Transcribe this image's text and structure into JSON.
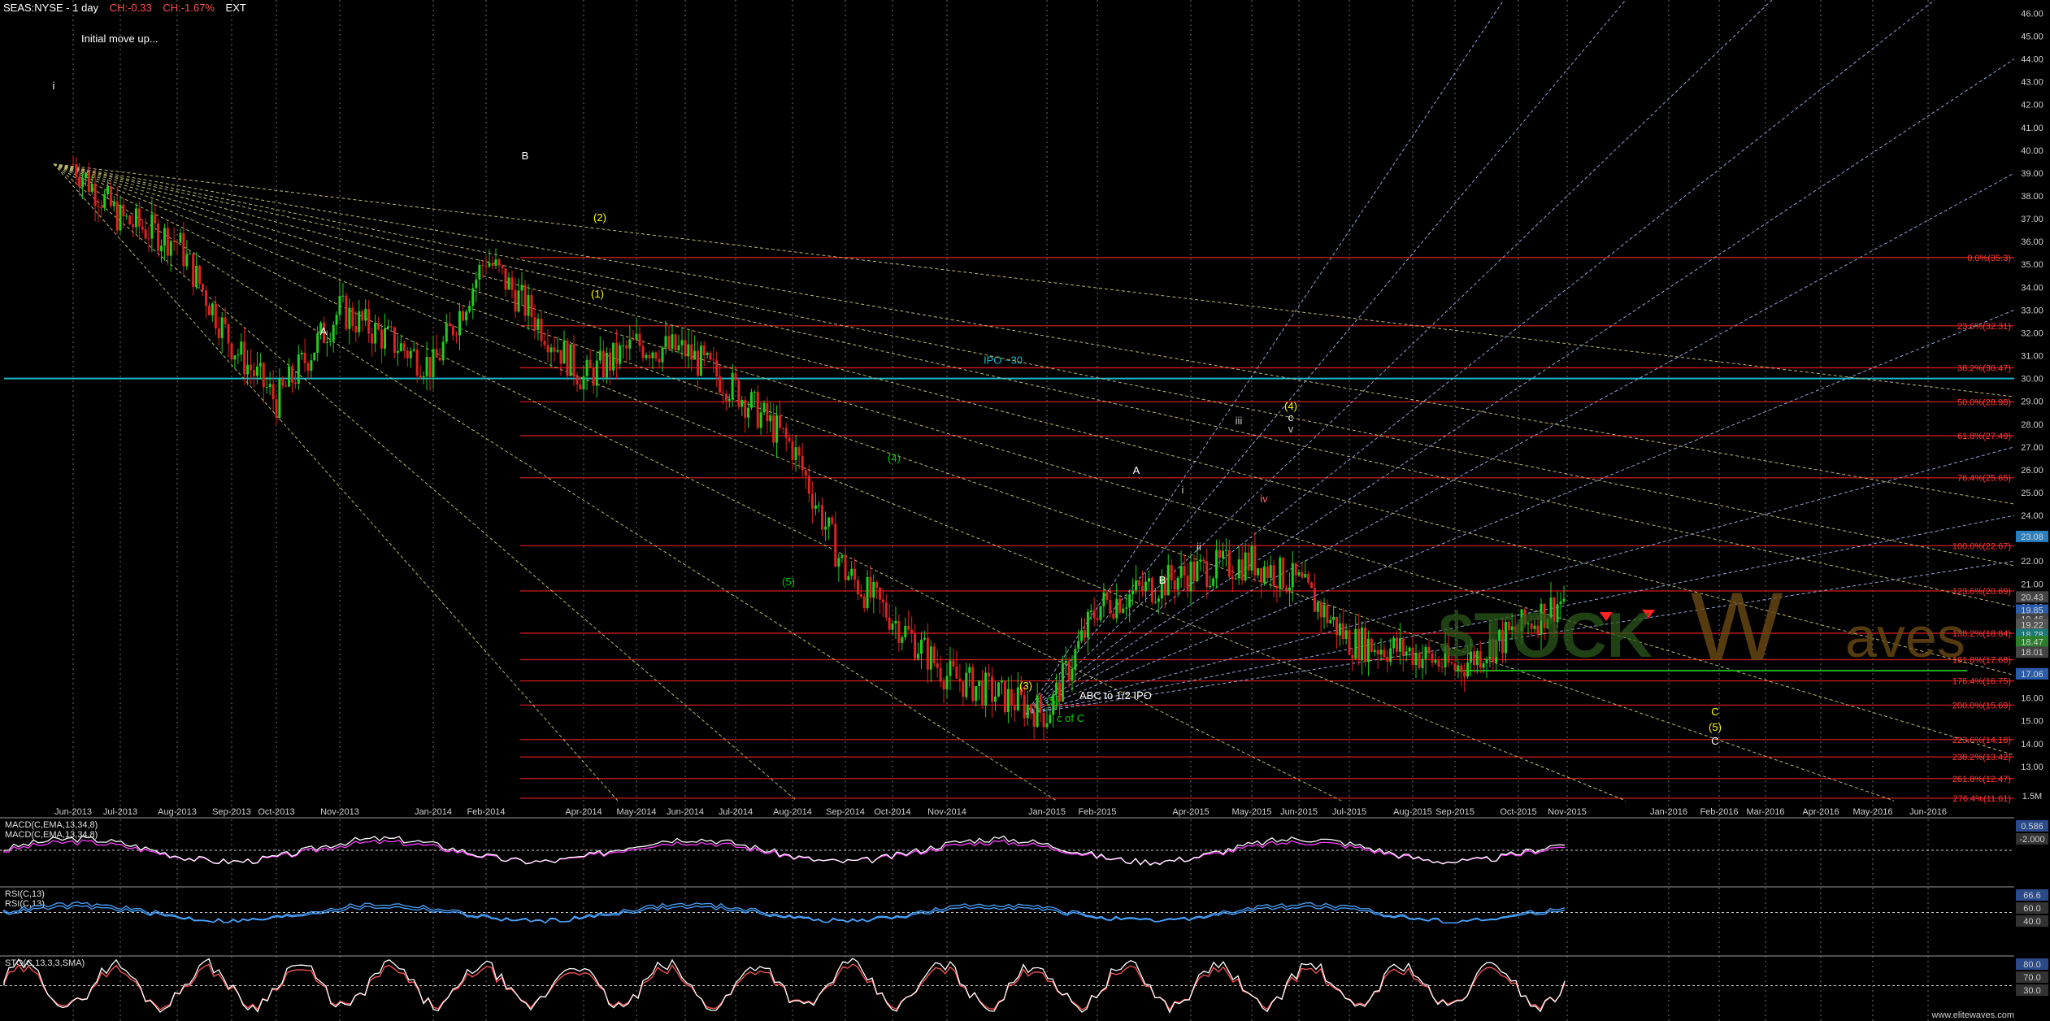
{
  "header": {
    "symbol": "SEAS:NYSE - 1 day",
    "change_abs": "CH:-0.33",
    "change_pct": "CH:-1.67%",
    "ext": "EXT"
  },
  "colors": {
    "background": "#000000",
    "candle_up": "#22cc22",
    "candle_down": "#dd2222",
    "fib_lines": "#d11b1b",
    "fan_yellow": "#bdb76b",
    "fan_blue": "#8fa4d8",
    "ipo_line": "#19b9c8",
    "macd_line": "#ffffff",
    "macd_signal": "#ff40ff",
    "rsi_line": "#4aa3ff",
    "stoch_k": "#ffffff",
    "stoch_d": "#ff5555",
    "watermark": "#2e5d1c"
  },
  "watermark": {
    "part1": "$TOCK",
    "part2": "aves",
    "w": "W",
    "site": "www.elitewaves.com"
  },
  "chart_data": {
    "type": "line",
    "title": "SEAS:NYSE - 1 day",
    "x_ticks": [
      "Jun-2013",
      "Jul-2013",
      "Aug-2013",
      "Sep-2013",
      "Oct-2013",
      "Nov-2013",
      "Jan-2014",
      "Feb-2014",
      "Apr-2014",
      "May-2014",
      "Jun-2014",
      "Jul-2014",
      "Aug-2014",
      "Sep-2014",
      "Oct-2014",
      "Nov-2014",
      "Jan-2015",
      "Feb-2015",
      "Apr-2015",
      "May-2015",
      "Jun-2015",
      "Jul-2015",
      "Aug-2015",
      "Sep-2015",
      "Oct-2015",
      "Nov-2015",
      "Jan-2016",
      "Feb-2016",
      "Mar-2016",
      "Apr-2016",
      "May-2016",
      "Jun-2016"
    ],
    "y_ticks": [
      13.0,
      14.0,
      15.0,
      16.0,
      17.0,
      18.0,
      19.0,
      20.0,
      21.0,
      22.0,
      23.0,
      24.0,
      25.0,
      26.0,
      27.0,
      28.0,
      29.0,
      30.0,
      31.0,
      32.0,
      33.0,
      34.0,
      35.0,
      36.0,
      37.0,
      38.0,
      39.0,
      40.0,
      41.0,
      42.0,
      43.0,
      44.0,
      45.0,
      46.0
    ],
    "ylim": [
      11.5,
      46.3
    ],
    "price_path": [
      [
        "Jun-2013",
        39.4
      ],
      [
        "Jul-2013",
        37.0
      ],
      [
        "Aug-2013",
        36.0
      ],
      [
        "Sep-2013",
        31.5
      ],
      [
        "Oct-2013",
        29.0
      ],
      [
        "Nov-2013",
        33.0
      ],
      [
        "Jan-2014",
        30.5
      ],
      [
        "Feb-2014",
        35.3
      ],
      [
        "Apr-2014",
        30.0
      ],
      [
        "May-2014",
        31.5
      ],
      [
        "Jun-2014",
        31.2
      ],
      [
        "Jul-2014",
        29.5
      ],
      [
        "Aug-2014",
        27.0
      ],
      [
        "Sep-2014",
        21.5
      ],
      [
        "Oct-2014",
        19.5
      ],
      [
        "Nov-2014",
        17.0
      ],
      [
        "Jan-2015",
        15.3
      ],
      [
        "Feb-2015",
        20.0
      ],
      [
        "Apr-2015",
        21.5
      ],
      [
        "May-2015",
        22.0
      ],
      [
        "Jun-2015",
        21.0
      ],
      [
        "Jul-2015",
        18.5
      ],
      [
        "Aug-2015",
        18.0
      ],
      [
        "Sep-2015",
        17.3
      ],
      [
        "Oct-2015",
        19.0
      ],
      [
        "Nov-2015",
        20.43
      ]
    ],
    "price_labels": [
      "23.08",
      "20.43",
      "19.85",
      "19.46",
      "19.22",
      "18.78",
      "18.47",
      "18.01",
      "17.06"
    ],
    "fib_levels": [
      {
        "label": "0.0%(35.3)",
        "value": 35.3
      },
      {
        "label": "23.6%(32.31)",
        "value": 32.31
      },
      {
        "label": "38.2%(30.47)",
        "value": 30.47
      },
      {
        "label": "50.0%(28.98)",
        "value": 28.98
      },
      {
        "label": "61.8%(27.49)",
        "value": 27.49
      },
      {
        "label": "76.4%(25.65)",
        "value": 25.65
      },
      {
        "label": "100.0%(22.67)",
        "value": 22.67
      },
      {
        "label": "123.6%(20.69)",
        "value": 20.69
      },
      {
        "label": "138.2%(18.84)",
        "value": 18.84
      },
      {
        "label": "161.8%(17.68)",
        "value": 17.68
      },
      {
        "label": "176.4%(16.75)",
        "value": 16.75
      },
      {
        "label": "200.0%(15.69)",
        "value": 15.69
      },
      {
        "label": "223.6%(14.18)",
        "value": 14.18
      },
      {
        "label": "238.2%(13.42)",
        "value": 13.42
      },
      {
        "label": "261.8%(12.47)",
        "value": 12.47
      },
      {
        "label": "276.4%(11.61)",
        "value": 11.61
      }
    ],
    "ipo_level": 30.0,
    "annotations": [
      "Initial move up...",
      "IPO ~30",
      "ABC to 1/2 IPO",
      "c of C"
    ],
    "wave_labels": [
      "i",
      "A",
      "B",
      "(1)",
      "(2)",
      "(3)",
      "(4)",
      "(5)",
      "(5)",
      "C",
      "A",
      "B",
      "c",
      "iii",
      "iv",
      "v",
      "i",
      "ii",
      "(4)",
      "(5)",
      "C"
    ]
  },
  "indicators": {
    "macd": {
      "label1": "MACD(C,EMA,13,34,8)",
      "label2": "MACD(C,EMA,13,34,8)",
      "value1": "0.586",
      "value2": "-2.000"
    },
    "rsi": {
      "label1": "RSI(C,13)",
      "label2": "RSI(C,13)",
      "value1": "66.6",
      "value2": "60.0",
      "value3": "40.0"
    },
    "stoch": {
      "label1": "STO(C,13,3,3,SMA)",
      "value1": "80.0",
      "value2": "70.0",
      "value3": "30.0"
    }
  },
  "volume_label": "1.5M"
}
